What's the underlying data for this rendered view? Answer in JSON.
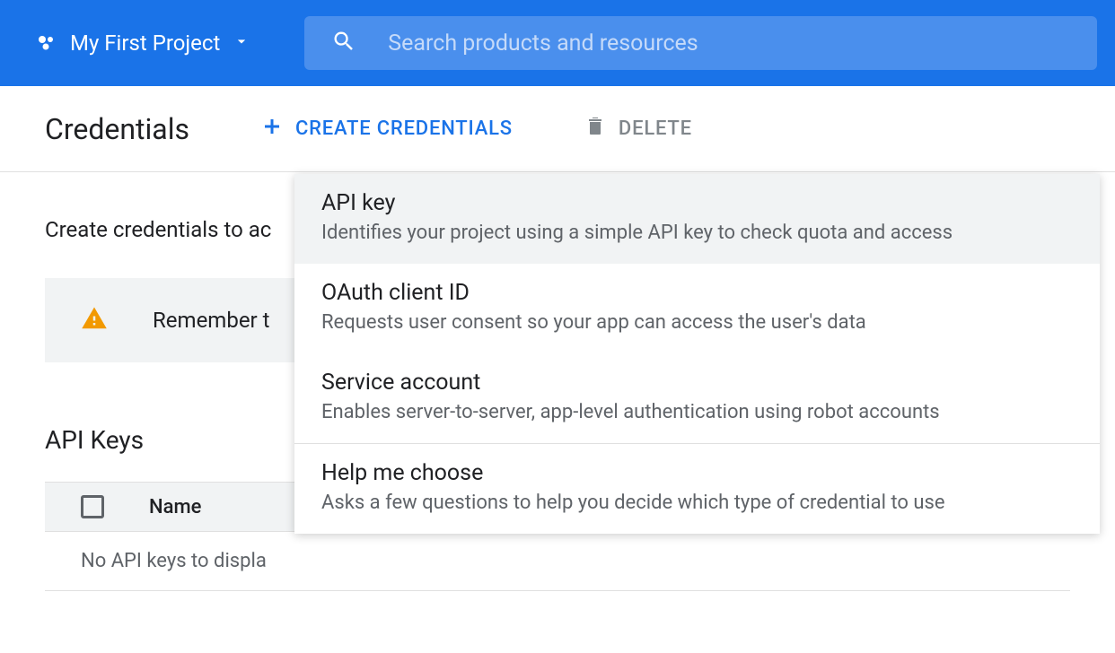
{
  "header": {
    "project_name": "My First Project",
    "search_placeholder": "Search products and resources"
  },
  "toolbar": {
    "title": "Credentials",
    "create_label": "CREATE CREDENTIALS",
    "delete_label": "DELETE"
  },
  "content": {
    "intro": "Create credentials to ac",
    "banner_text": "Remember t",
    "section_title": "API Keys",
    "table": {
      "col_name": "Name",
      "empty_text": "No API keys to displa"
    }
  },
  "dropdown": {
    "items": [
      {
        "title": "API key",
        "desc": "Identifies your project using a simple API key to check quota and access"
      },
      {
        "title": "OAuth client ID",
        "desc": "Requests user consent so your app can access the user's data"
      },
      {
        "title": "Service account",
        "desc": "Enables server-to-server, app-level authentication using robot accounts"
      },
      {
        "title": "Help me choose",
        "desc": "Asks a few questions to help you decide which type of credential to use"
      }
    ]
  }
}
